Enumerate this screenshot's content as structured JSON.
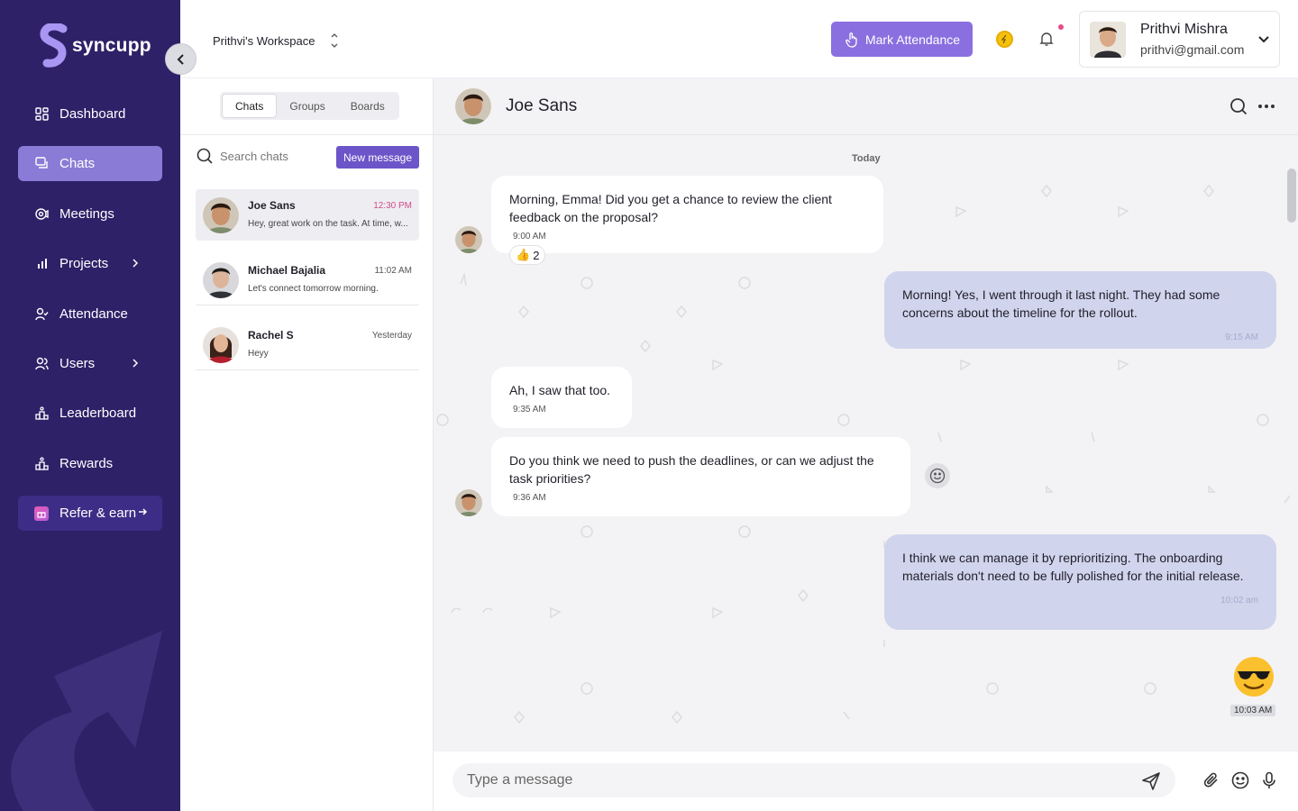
{
  "sidebar": {
    "logo_text": "syncupp",
    "items": [
      {
        "label": "Dashboard",
        "icon": "dashboard-icon"
      },
      {
        "label": "Chats",
        "icon": "chat-icon",
        "active": true
      },
      {
        "label": "Meetings",
        "icon": "meetings-icon"
      },
      {
        "label": "Projects",
        "icon": "projects-icon",
        "has_submenu": true
      },
      {
        "label": "Attendance",
        "icon": "attendance-icon"
      },
      {
        "label": "Users",
        "icon": "users-icon",
        "has_submenu": true
      },
      {
        "label": "Leaderboard",
        "icon": "leaderboard-icon"
      },
      {
        "label": "Rewards",
        "icon": "rewards-icon"
      }
    ],
    "refer_label": "Refer & earn"
  },
  "topbar": {
    "workspace": "Prithvi's Workspace",
    "mark_attendance": "Mark Attendance",
    "profile": {
      "name": "Prithvi Mishra",
      "email": "prithvi@gmail.com"
    }
  },
  "chat_list": {
    "tabs": [
      "Chats",
      "Groups",
      "Boards"
    ],
    "search_placeholder": "Search chats",
    "new_message": "New message",
    "items": [
      {
        "name": "Joe Sans",
        "time": "12:30 PM",
        "preview": "Hey, great work on the task. At time, w...",
        "active": true
      },
      {
        "name": "Michael Bajalia",
        "time": "11:02 AM",
        "preview": "Let's connect tomorrow morning."
      },
      {
        "name": "Rachel S",
        "time": "Yesterday",
        "preview": "Heyy"
      }
    ]
  },
  "conversation": {
    "title": "Joe Sans",
    "day": "Today",
    "messages": [
      {
        "dir": "in",
        "text": "Morning, Emma! Did you get a chance to review the client feedback on the proposal?",
        "time": "9:00 AM"
      },
      {
        "dir": "out",
        "text": "Morning! Yes, I went through it last night. They had some concerns about the timeline for the rollout.",
        "time": "9:15 AM"
      },
      {
        "dir": "in",
        "text": "Ah, I saw that too.",
        "time": "9:35 AM"
      },
      {
        "dir": "in",
        "text": "Do you think we need to push the deadlines, or can we adjust the task priorities?",
        "time": "9:36 AM"
      },
      {
        "dir": "out",
        "text": "I think we can manage it by reprioritizing. The onboarding materials don't need to be fully polished for the initial release.",
        "time": "10:02 am"
      }
    ],
    "reaction": {
      "emoji": "👍",
      "count": "2"
    },
    "emoji_message": {
      "emoji": "sunglasses-emoji",
      "time": "10:03 AM"
    },
    "composer_placeholder": "Type a message"
  },
  "colors": {
    "sidebar": "#2f2168",
    "accent": "#8a6fe0",
    "active_nav": "#8a7bd6",
    "outgoing_bubble": "#d1d4ed"
  }
}
